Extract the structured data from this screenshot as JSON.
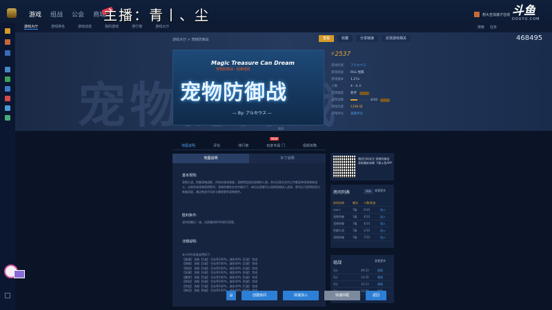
{
  "topnav": {
    "items": [
      {
        "label": "游戏",
        "active": true
      },
      {
        "label": "组战"
      },
      {
        "label": "公会"
      },
      {
        "label": "商城"
      }
    ]
  },
  "overlay": {
    "streamer": "主播：青丨、尘"
  },
  "user": {
    "name": "想大吉加速才在线"
  },
  "brand": {
    "logo_big": "斗鱼",
    "logo_small": "DOUYU.COM"
  },
  "subnav": {
    "items": [
      {
        "label": "游戏大厅",
        "active": true
      },
      {
        "label": "游戏排名"
      },
      {
        "label": "游戏动态"
      },
      {
        "label": "我的游戏"
      },
      {
        "label": "排行榜"
      },
      {
        "label": "游戏大厅"
      }
    ]
  },
  "subright": {
    "a": "搜索",
    "b": "任务"
  },
  "breadcrumb": "游戏大厅 > 宠物防御战",
  "actions": {
    "primary": "查看",
    "b": "收藏",
    "c": "分享链接",
    "d": "反馈游戏相关"
  },
  "viewer_count": "468495",
  "cover": {
    "en_title": "Magic Treasure Can Dream",
    "sub": "宠物防御战 · 经典塔防",
    "title": "宠物防御战",
    "by": "— By: アルセウス —",
    "caption": "截图"
  },
  "score": "2537",
  "info": [
    {
      "k": "游戏作者",
      "v": "アルセウス",
      "style": "blue"
    },
    {
      "k": "游戏类型",
      "v": "RGL 经典"
    },
    {
      "k": "游戏版本",
      "v": "1.27a"
    },
    {
      "k": "人数",
      "v": "4 - 4 人"
    },
    {
      "k": "游戏难度",
      "v": "新手",
      "pill": true
    },
    {
      "k": "推荐指数",
      "v": "4/10",
      "bar": 0.4,
      "pill": true
    },
    {
      "k": "游戏热度",
      "v": "1296 场",
      "style": "orange"
    },
    {
      "k": "游戏评论",
      "v": "查看评论",
      "style": "blue"
    }
  ],
  "tabs": {
    "items": [
      {
        "label": "地图说明",
        "active": true
      },
      {
        "label": "评论"
      },
      {
        "label": "排行榜"
      },
      {
        "label": "玩家专属 门"
      },
      {
        "label": "视频攻略"
      }
    ],
    "new_badge": "NEW"
  },
  "panel": {
    "tab_a": "地图说明",
    "tab_b": "补丁说明",
    "s1": "基本规则:",
    "p1": "宠物大战，防御宠物战胜，所有的游戏难度，宠物将会抵抗怪物的入侵。多位玩家在合作之中都会带领宠物来战斗，击败所有怪物获得胜利，宠物的属性在合作模式下，每位玩家都可以选择宠物进入战场，胜利后可获得经验与装备奖励，通过挑战不同关卡解锁更多宠物角色。",
    "s2": "胜利条件:",
    "p2": "坚持到最后一波，击败最终BOSS即可获胜。",
    "s3": "详细说明:",
    "rules": [
      "关卡评价标准说明如下：",
      "【普通】 消耗【1波】 生存率100%，减伤40%【1波】 完成",
      "【困难】 消耗【2波】 生存率100%，减伤40%【2波】 完成",
      "【地狱】 消耗【3波】 生存率100%，减伤40%【3波】 完成",
      "【深渊】 消耗【4波】 生存率100%，减伤40%【4波】 完成",
      "【噩梦】 消耗【5波】 生存率100%，减伤40%【5波】 完成",
      "【炼狱】 消耗【6波】 生存率100%，减伤40%【6波】 完成",
      "【传说】 消耗【7波】 生存率100%，减伤40%【7波】 完成",
      "【神话】 消耗【8波】 生存率100%，减伤40%【8波】 完成"
    ]
  },
  "qr": {
    "text": "微信扫码关注 宠物防御战 获取最新攻略 下载斗鱼APP"
  },
  "roomlist": {
    "title": "房间列表",
    "b1": "刷新",
    "b2": "查看更多",
    "headers": [
      "房间名称",
      "模式",
      "人数/状态",
      ""
    ],
    "rows": [
      {
        "name": "aaa人",
        "mode": "7级",
        "num": "6/10",
        "act": "加入"
      },
      {
        "name": "宠物防御",
        "mode": "1级",
        "num": "4/10",
        "act": "加入"
      },
      {
        "name": "宠物防御",
        "mode": "7级",
        "num": "4/10",
        "act": "加入"
      },
      {
        "name": "防御大战",
        "mode": "7级",
        "num": "1/10",
        "act": "加入"
      },
      {
        "name": "宠物防御",
        "mode": "7级",
        "num": "7/10",
        "act": "加入"
      }
    ]
  },
  "ranks": {
    "title": "组战",
    "more": "查看更多",
    "rows": [
      {
        "a": "3分",
        "b": "09:23",
        "c": "围观"
      },
      {
        "a": "5分",
        "b": "14:35",
        "c": "围观"
      },
      {
        "a": "4分",
        "b": "12:11",
        "c": "围观"
      },
      {
        "a": "3分",
        "b": "13:02",
        "c": "围观"
      }
    ]
  },
  "bottom": {
    "create": "创建房间",
    "join": "快速加入",
    "match": "快速匹配",
    "back": "返回"
  },
  "colors": {
    "accent": "#2d7fd6",
    "gold": "#d59a2a",
    "score": "#e6a63a"
  }
}
